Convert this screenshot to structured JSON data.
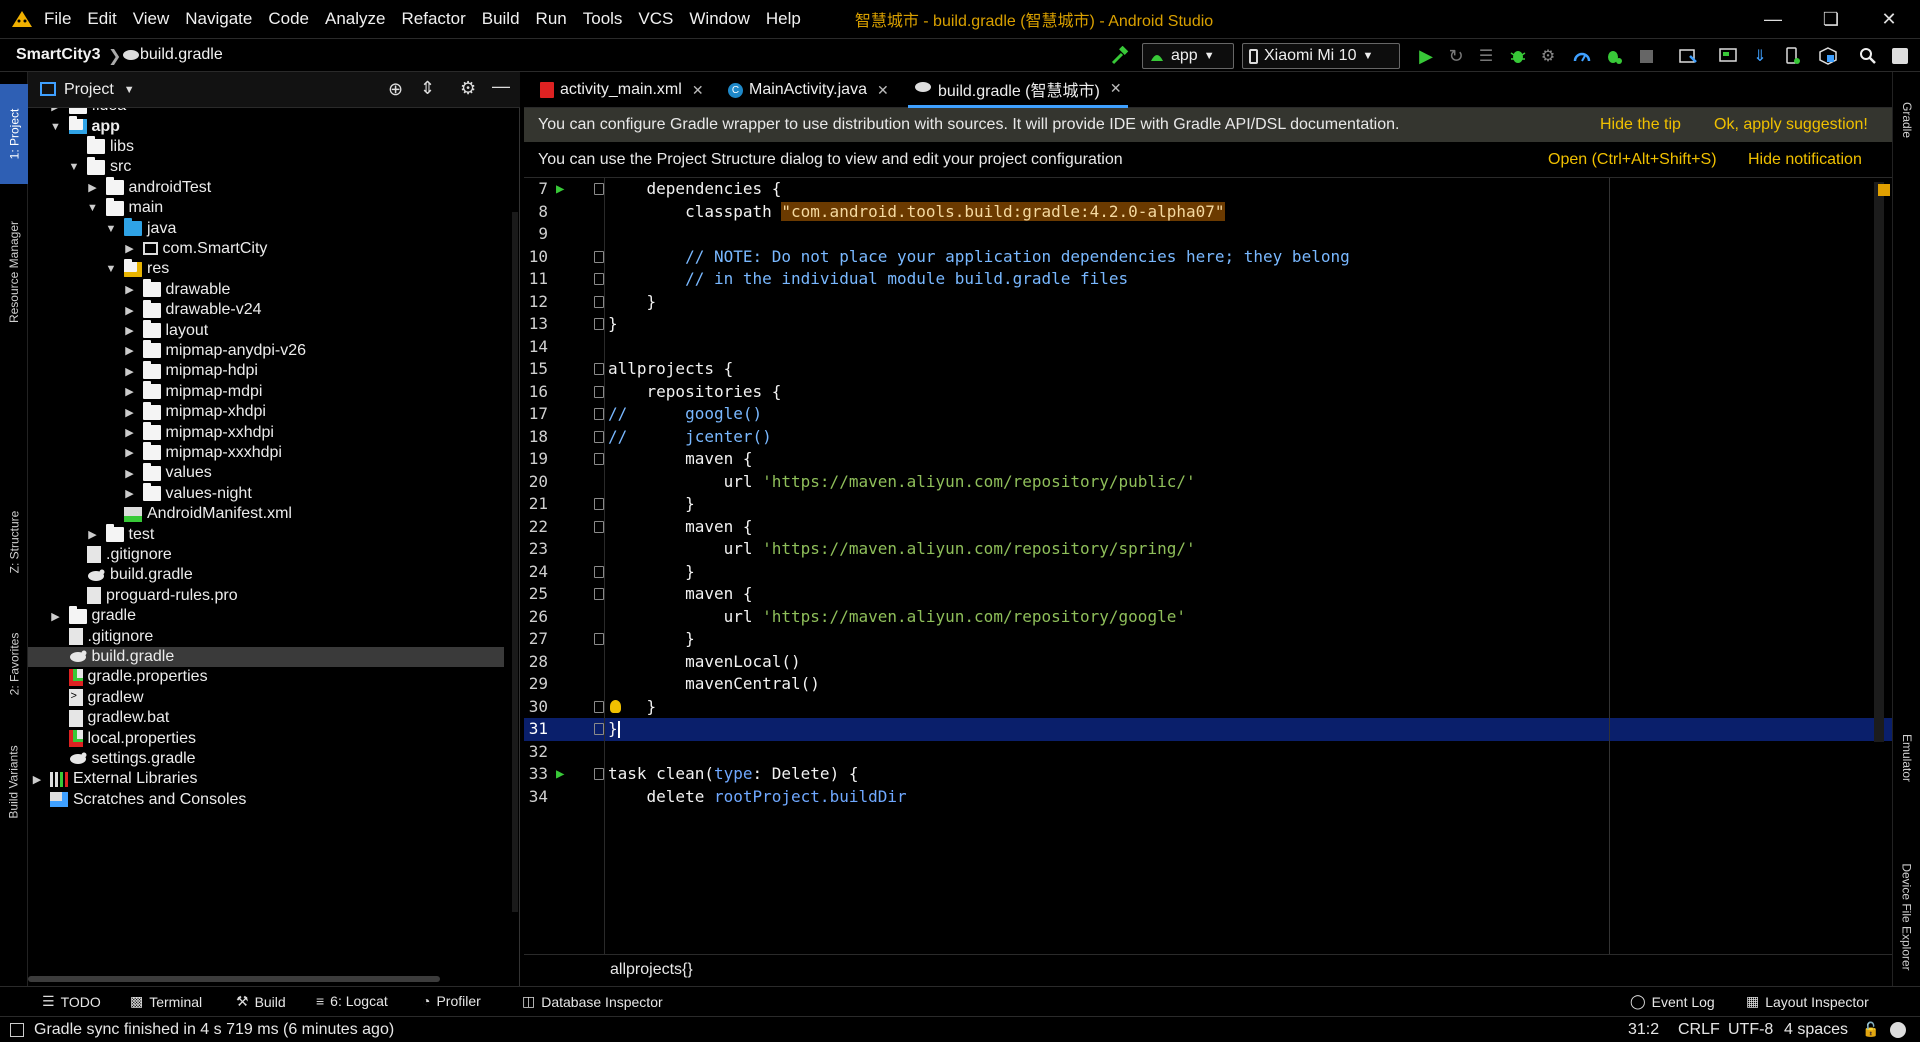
{
  "app": {
    "window_title": "智慧城市 - build.gradle (智慧城市) - Android Studio",
    "menu": [
      "File",
      "Edit",
      "View",
      "Navigate",
      "Code",
      "Analyze",
      "Refactor",
      "Build",
      "Run",
      "Tools",
      "VCS",
      "Window",
      "Help"
    ]
  },
  "navbar": {
    "project": "SmartCity3",
    "file": "build.gradle",
    "run_config": "app",
    "device": "Xiaomi Mi 10"
  },
  "left_stripe": {
    "project_tab": "1: Project",
    "resource_manager_tab": "Resource Manager",
    "structure_tab": "Z: Structure",
    "favorites_tab": "2: Favorites",
    "build_variants_tab": "Build Variants"
  },
  "right_stripe": {
    "gradle_tab": "Gradle",
    "emulator_tab": "Emulator",
    "device_file_explorer_tab": "Device File Explorer"
  },
  "project_panel": {
    "title": "Project",
    "tree": [
      {
        "label": ".idea",
        "level": 1,
        "arrow": "▶",
        "icon": "folder"
      },
      {
        "label": "app",
        "level": 1,
        "arrow": "▼",
        "icon": "folder-module",
        "bold": true
      },
      {
        "label": "libs",
        "level": 2,
        "arrow": "",
        "icon": "folder"
      },
      {
        "label": "src",
        "level": 2,
        "arrow": "▼",
        "icon": "folder"
      },
      {
        "label": "androidTest",
        "level": 3,
        "arrow": "▶",
        "icon": "folder"
      },
      {
        "label": "main",
        "level": 3,
        "arrow": "▼",
        "icon": "folder"
      },
      {
        "label": "java",
        "level": 4,
        "arrow": "▼",
        "icon": "folder-blue"
      },
      {
        "label": "com.SmartCity",
        "level": 5,
        "arrow": "▶",
        "icon": "package"
      },
      {
        "label": "res",
        "level": 4,
        "arrow": "▼",
        "icon": "folder-res"
      },
      {
        "label": "drawable",
        "level": 5,
        "arrow": "▶",
        "icon": "folder"
      },
      {
        "label": "drawable-v24",
        "level": 5,
        "arrow": "▶",
        "icon": "folder"
      },
      {
        "label": "layout",
        "level": 5,
        "arrow": "▶",
        "icon": "folder"
      },
      {
        "label": "mipmap-anydpi-v26",
        "level": 5,
        "arrow": "▶",
        "icon": "folder"
      },
      {
        "label": "mipmap-hdpi",
        "level": 5,
        "arrow": "▶",
        "icon": "folder"
      },
      {
        "label": "mipmap-mdpi",
        "level": 5,
        "arrow": "▶",
        "icon": "folder"
      },
      {
        "label": "mipmap-xhdpi",
        "level": 5,
        "arrow": "▶",
        "icon": "folder"
      },
      {
        "label": "mipmap-xxhdpi",
        "level": 5,
        "arrow": "▶",
        "icon": "folder"
      },
      {
        "label": "mipmap-xxxhdpi",
        "level": 5,
        "arrow": "▶",
        "icon": "folder"
      },
      {
        "label": "values",
        "level": 5,
        "arrow": "▶",
        "icon": "folder"
      },
      {
        "label": "values-night",
        "level": 5,
        "arrow": "▶",
        "icon": "folder"
      },
      {
        "label": "AndroidManifest.xml",
        "level": 4,
        "arrow": "",
        "icon": "manifest"
      },
      {
        "label": "test",
        "level": 3,
        "arrow": "▶",
        "icon": "folder"
      },
      {
        "label": ".gitignore",
        "level": 2,
        "arrow": "",
        "icon": "file"
      },
      {
        "label": "build.gradle",
        "level": 2,
        "arrow": "",
        "icon": "gradle"
      },
      {
        "label": "proguard-rules.pro",
        "level": 2,
        "arrow": "",
        "icon": "file"
      },
      {
        "label": "gradle",
        "level": 1,
        "arrow": "▶",
        "icon": "folder"
      },
      {
        "label": ".gitignore",
        "level": 1,
        "arrow": "",
        "icon": "file"
      },
      {
        "label": "build.gradle",
        "level": 1,
        "arrow": "",
        "icon": "gradle",
        "selected": true
      },
      {
        "label": "gradle.properties",
        "level": 1,
        "arrow": "",
        "icon": "properties"
      },
      {
        "label": "gradlew",
        "level": 1,
        "arrow": "",
        "icon": "script"
      },
      {
        "label": "gradlew.bat",
        "level": 1,
        "arrow": "",
        "icon": "file"
      },
      {
        "label": "local.properties",
        "level": 1,
        "arrow": "",
        "icon": "properties"
      },
      {
        "label": "settings.gradle",
        "level": 1,
        "arrow": "",
        "icon": "gradle"
      },
      {
        "label": "External Libraries",
        "level": 0,
        "arrow": "▶",
        "icon": "libraries"
      },
      {
        "label": "Scratches and Consoles",
        "level": 0,
        "arrow": "",
        "icon": "scratches"
      }
    ]
  },
  "editor": {
    "tabs": [
      {
        "label": "activity_main.xml",
        "icon": "xml-icon"
      },
      {
        "label": "MainActivity.java",
        "icon": "class-icon"
      },
      {
        "label": "build.gradle (智慧城市)",
        "icon": "gradle-icon",
        "active": true
      }
    ],
    "notification1": {
      "text": "You can configure Gradle wrapper to use distribution with sources. It will provide IDE with Gradle API/DSL documentation.",
      "action1": "Hide the tip",
      "action2": "Ok, apply suggestion!"
    },
    "notification2": {
      "text": "You can use the Project Structure dialog to view and edit your project configuration",
      "action1": "Open (Ctrl+Alt+Shift+S)",
      "action2": "Hide notification"
    },
    "current_line": 31,
    "lines": [
      {
        "n": "7",
        "run": true,
        "fold": true,
        "html": "    dependencies {"
      },
      {
        "n": "8",
        "html": "        classpath <span class=\"hl\">\"com.android.tools.build:gradle:4.2.0-alpha07\"</span>"
      },
      {
        "n": "9",
        "html": ""
      },
      {
        "n": "10",
        "fold": true,
        "html": "        <span class=\"cmt\">// NOTE: Do not place your application dependencies here; they belong</span>"
      },
      {
        "n": "11",
        "fold": true,
        "html": "        <span class=\"cmt\">// in the individual module build.gradle files</span>"
      },
      {
        "n": "12",
        "fold": true,
        "html": "    }"
      },
      {
        "n": "13",
        "fold": true,
        "html": "}"
      },
      {
        "n": "14",
        "html": ""
      },
      {
        "n": "15",
        "fold": true,
        "html": "allprojects {"
      },
      {
        "n": "16",
        "fold": true,
        "html": "    repositories {"
      },
      {
        "n": "17",
        "fold": true,
        "html": "<span class=\"cmt\">//      google()</span>"
      },
      {
        "n": "18",
        "fold": true,
        "html": "<span class=\"cmt\">//      jcenter()</span>"
      },
      {
        "n": "19",
        "fold": true,
        "html": "        maven {"
      },
      {
        "n": "20",
        "html": "            url <span class=\"str\">'https://maven.aliyun.com/repository/public/'</span>"
      },
      {
        "n": "21",
        "fold": true,
        "html": "        }"
      },
      {
        "n": "22",
        "fold": true,
        "html": "        maven {"
      },
      {
        "n": "23",
        "html": "            url <span class=\"str\">'https://maven.aliyun.com/repository/spring/'</span>"
      },
      {
        "n": "24",
        "fold": true,
        "html": "        }"
      },
      {
        "n": "25",
        "fold": true,
        "html": "        maven {"
      },
      {
        "n": "26",
        "html": "            url <span class=\"str\">'https://maven.aliyun.com/repository/google'</span>"
      },
      {
        "n": "27",
        "fold": true,
        "html": "        }"
      },
      {
        "n": "28",
        "html": "        mavenLocal()"
      },
      {
        "n": "29",
        "html": "        mavenCentral()"
      },
      {
        "n": "30",
        "fold": true,
        "bulb": true,
        "html": "    }"
      },
      {
        "n": "31",
        "fold": true,
        "current": true,
        "html": "}"
      },
      {
        "n": "32",
        "html": ""
      },
      {
        "n": "33",
        "run": true,
        "fold": true,
        "html": "task clean(<span class=\"param\">type</span>: Delete) {"
      },
      {
        "n": "34",
        "html": "    delete <span class=\"fn\">rootProject.buildDir</span>"
      }
    ],
    "breadcrumb": "allprojects{}"
  },
  "bottom_tools": {
    "todo": "TODO",
    "terminal": "Terminal",
    "build": "Build",
    "logcat": "6: Logcat",
    "profiler": "Profiler",
    "database_inspector": "Database Inspector",
    "event_log": "Event Log",
    "layout_inspector": "Layout Inspector"
  },
  "status": {
    "message": "Gradle sync finished in 4 s 719 ms (6 minutes ago)",
    "position": "31:2",
    "line_sep": "CRLF",
    "encoding": "UTF-8",
    "indent": "4 spaces"
  },
  "colors": {
    "accent": "#3fa0ff",
    "selection": "#0a1f6b",
    "tip": "#f0c000",
    "run": "#38c938"
  }
}
